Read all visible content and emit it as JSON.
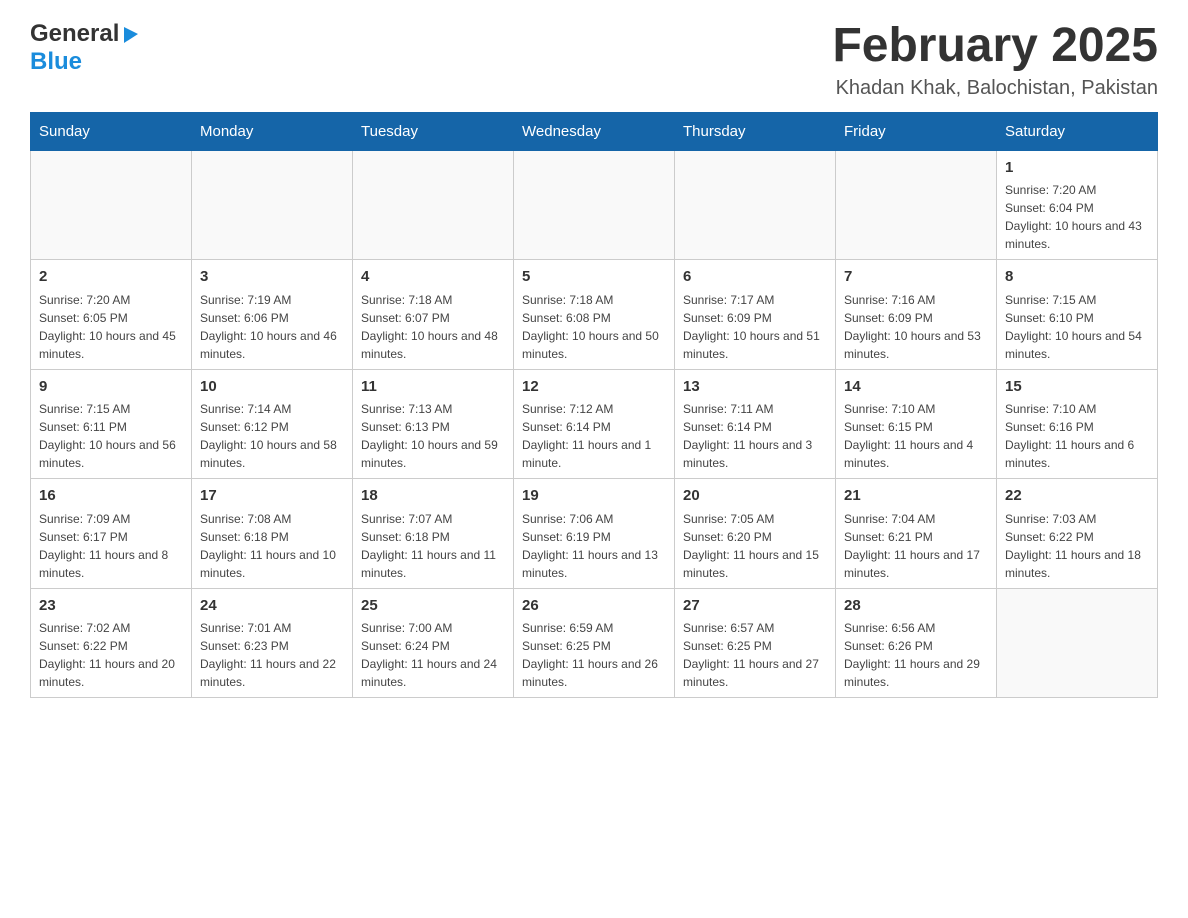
{
  "header": {
    "logo_general": "General",
    "logo_blue": "Blue",
    "month_title": "February 2025",
    "location": "Khadan Khak, Balochistan, Pakistan"
  },
  "weekdays": [
    "Sunday",
    "Monday",
    "Tuesday",
    "Wednesday",
    "Thursday",
    "Friday",
    "Saturday"
  ],
  "rows": [
    [
      {
        "day": "",
        "info": ""
      },
      {
        "day": "",
        "info": ""
      },
      {
        "day": "",
        "info": ""
      },
      {
        "day": "",
        "info": ""
      },
      {
        "day": "",
        "info": ""
      },
      {
        "day": "",
        "info": ""
      },
      {
        "day": "1",
        "info": "Sunrise: 7:20 AM\nSunset: 6:04 PM\nDaylight: 10 hours and 43 minutes."
      }
    ],
    [
      {
        "day": "2",
        "info": "Sunrise: 7:20 AM\nSunset: 6:05 PM\nDaylight: 10 hours and 45 minutes."
      },
      {
        "day": "3",
        "info": "Sunrise: 7:19 AM\nSunset: 6:06 PM\nDaylight: 10 hours and 46 minutes."
      },
      {
        "day": "4",
        "info": "Sunrise: 7:18 AM\nSunset: 6:07 PM\nDaylight: 10 hours and 48 minutes."
      },
      {
        "day": "5",
        "info": "Sunrise: 7:18 AM\nSunset: 6:08 PM\nDaylight: 10 hours and 50 minutes."
      },
      {
        "day": "6",
        "info": "Sunrise: 7:17 AM\nSunset: 6:09 PM\nDaylight: 10 hours and 51 minutes."
      },
      {
        "day": "7",
        "info": "Sunrise: 7:16 AM\nSunset: 6:09 PM\nDaylight: 10 hours and 53 minutes."
      },
      {
        "day": "8",
        "info": "Sunrise: 7:15 AM\nSunset: 6:10 PM\nDaylight: 10 hours and 54 minutes."
      }
    ],
    [
      {
        "day": "9",
        "info": "Sunrise: 7:15 AM\nSunset: 6:11 PM\nDaylight: 10 hours and 56 minutes."
      },
      {
        "day": "10",
        "info": "Sunrise: 7:14 AM\nSunset: 6:12 PM\nDaylight: 10 hours and 58 minutes."
      },
      {
        "day": "11",
        "info": "Sunrise: 7:13 AM\nSunset: 6:13 PM\nDaylight: 10 hours and 59 minutes."
      },
      {
        "day": "12",
        "info": "Sunrise: 7:12 AM\nSunset: 6:14 PM\nDaylight: 11 hours and 1 minute."
      },
      {
        "day": "13",
        "info": "Sunrise: 7:11 AM\nSunset: 6:14 PM\nDaylight: 11 hours and 3 minutes."
      },
      {
        "day": "14",
        "info": "Sunrise: 7:10 AM\nSunset: 6:15 PM\nDaylight: 11 hours and 4 minutes."
      },
      {
        "day": "15",
        "info": "Sunrise: 7:10 AM\nSunset: 6:16 PM\nDaylight: 11 hours and 6 minutes."
      }
    ],
    [
      {
        "day": "16",
        "info": "Sunrise: 7:09 AM\nSunset: 6:17 PM\nDaylight: 11 hours and 8 minutes."
      },
      {
        "day": "17",
        "info": "Sunrise: 7:08 AM\nSunset: 6:18 PM\nDaylight: 11 hours and 10 minutes."
      },
      {
        "day": "18",
        "info": "Sunrise: 7:07 AM\nSunset: 6:18 PM\nDaylight: 11 hours and 11 minutes."
      },
      {
        "day": "19",
        "info": "Sunrise: 7:06 AM\nSunset: 6:19 PM\nDaylight: 11 hours and 13 minutes."
      },
      {
        "day": "20",
        "info": "Sunrise: 7:05 AM\nSunset: 6:20 PM\nDaylight: 11 hours and 15 minutes."
      },
      {
        "day": "21",
        "info": "Sunrise: 7:04 AM\nSunset: 6:21 PM\nDaylight: 11 hours and 17 minutes."
      },
      {
        "day": "22",
        "info": "Sunrise: 7:03 AM\nSunset: 6:22 PM\nDaylight: 11 hours and 18 minutes."
      }
    ],
    [
      {
        "day": "23",
        "info": "Sunrise: 7:02 AM\nSunset: 6:22 PM\nDaylight: 11 hours and 20 minutes."
      },
      {
        "day": "24",
        "info": "Sunrise: 7:01 AM\nSunset: 6:23 PM\nDaylight: 11 hours and 22 minutes."
      },
      {
        "day": "25",
        "info": "Sunrise: 7:00 AM\nSunset: 6:24 PM\nDaylight: 11 hours and 24 minutes."
      },
      {
        "day": "26",
        "info": "Sunrise: 6:59 AM\nSunset: 6:25 PM\nDaylight: 11 hours and 26 minutes."
      },
      {
        "day": "27",
        "info": "Sunrise: 6:57 AM\nSunset: 6:25 PM\nDaylight: 11 hours and 27 minutes."
      },
      {
        "day": "28",
        "info": "Sunrise: 6:56 AM\nSunset: 6:26 PM\nDaylight: 11 hours and 29 minutes."
      },
      {
        "day": "",
        "info": ""
      }
    ]
  ]
}
